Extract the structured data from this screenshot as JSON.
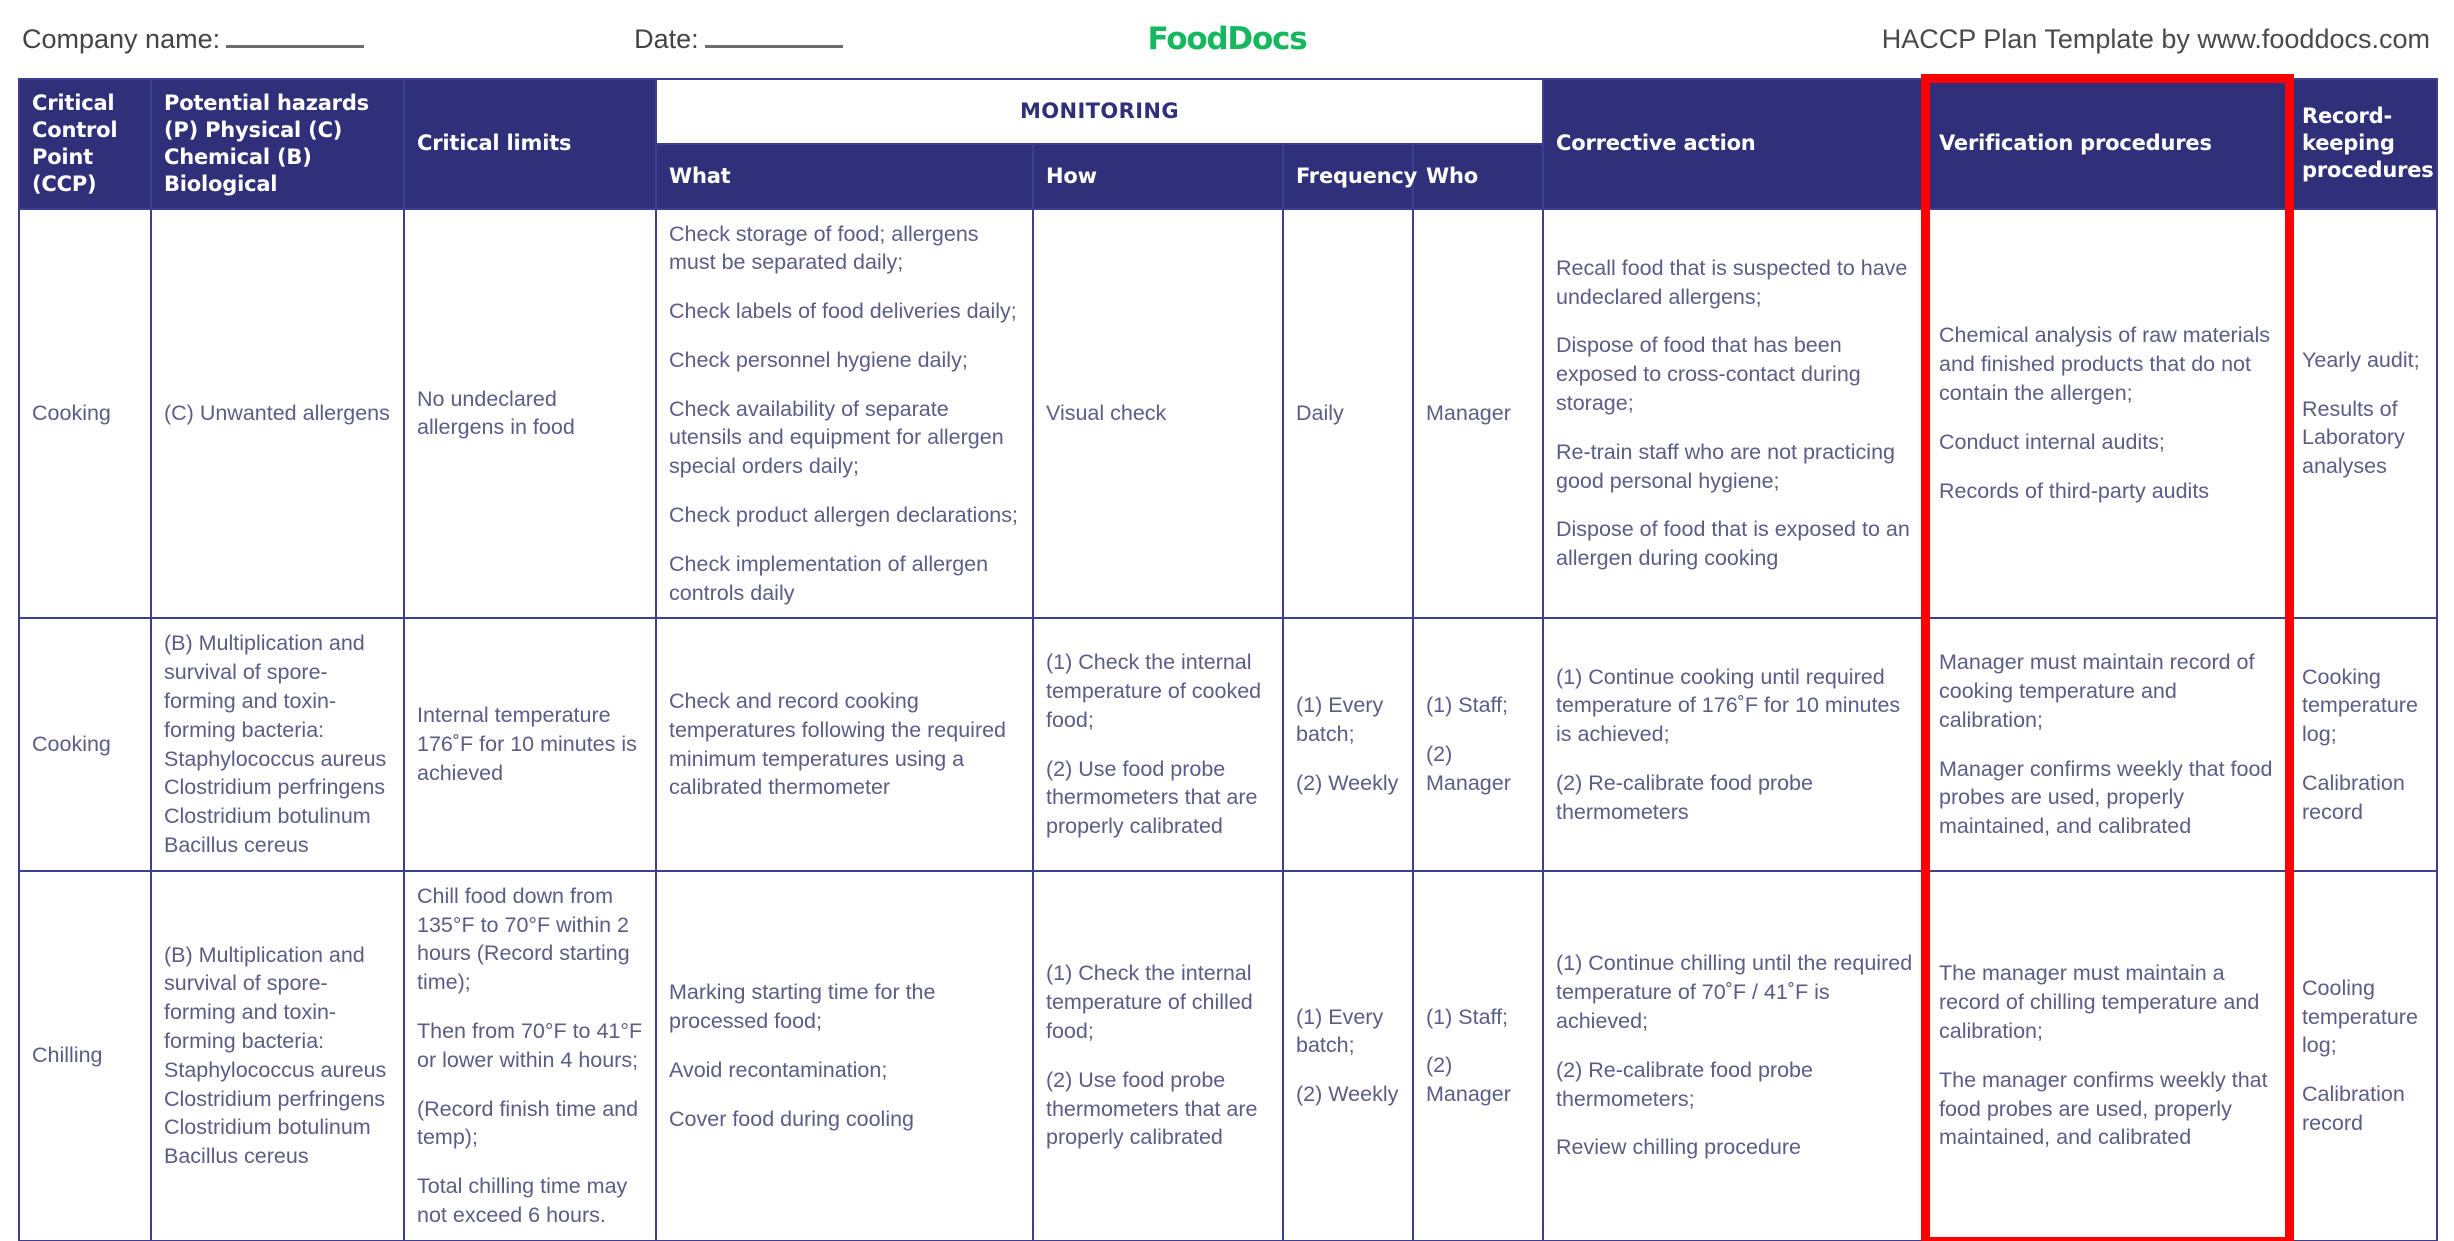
{
  "header": {
    "company_label": "Company name:",
    "date_label": "Date:",
    "logo_text": "FoodDocs",
    "logo_color": "#16b85f",
    "attribution": "HACCP Plan Template by www.fooddocs.com"
  },
  "theme": {
    "header_bg": "#2f2f7a",
    "border": "#3c3f8f",
    "body_text": "#5a5d86",
    "highlight": "#ff0000"
  },
  "table": {
    "group_header": "MONITORING",
    "columns": {
      "ccp": "Critical\nControl\nPoint\n(CCP)",
      "ccp_lines": [
        "Critical",
        "Control",
        "Point",
        "(CCP)"
      ],
      "hazards_lines": [
        "Potential hazards",
        "(P) Physical",
        "(C) Chemical",
        "(B) Biological"
      ],
      "critical_limits": "Critical limits",
      "what": "What",
      "how": "How",
      "frequency": "Frequency",
      "who": "Who",
      "corrective_action": "Corrective action",
      "verification": "Verification procedures",
      "recordkeeping_lines": [
        "Record-",
        "keeping",
        "procedures"
      ]
    },
    "rows": [
      {
        "ccp": "Cooking",
        "hazards": [
          "(C) Unwanted allergens"
        ],
        "critical_limits": [
          "No undeclared allergens in food"
        ],
        "what": [
          "Check storage of food; allergens must be separated daily;",
          "Check labels of food deliveries daily;",
          "Check personnel hygiene daily;",
          "Check availability of separate utensils and equipment for allergen special orders daily;",
          "Check product allergen declarations;",
          "Check implementation of allergen controls daily"
        ],
        "how": [
          "Visual check"
        ],
        "frequency": [
          "Daily"
        ],
        "who": [
          "Manager"
        ],
        "corrective_action": [
          "Recall food that is suspected to have undeclared allergens;",
          "Dispose of food that has been exposed to cross-contact during storage;",
          "Re-train staff who are not practicing good personal hygiene;",
          "Dispose of food that is exposed to an allergen during cooking"
        ],
        "verification": [
          "Chemical analysis of raw materials and finished products that do not contain the allergen;",
          "Conduct internal audits;",
          "Records of third-party audits"
        ],
        "recordkeeping": [
          "Yearly audit;",
          "Results of Laboratory analyses"
        ]
      },
      {
        "ccp": "Cooking",
        "hazards": [
          "(B) Multiplication and survival of spore-forming and toxin-forming bacteria: Staphylococcus aureus Clostridium perfringens Clostridium botulinum Bacillus cereus"
        ],
        "critical_limits": [
          "Internal temperature 176˚F for 10 minutes is achieved"
        ],
        "what": [
          "Check and record cooking temperatures following the required minimum temperatures using a calibrated thermometer"
        ],
        "how": [
          "(1) Check the internal temperature of cooked food;",
          "(2) Use food probe thermometers that are properly calibrated"
        ],
        "frequency": [
          "(1) Every batch;",
          "(2) Weekly"
        ],
        "who": [
          "(1) Staff;",
          "(2) Manager"
        ],
        "corrective_action": [
          "(1) Continue cooking until required temperature of 176˚F for 10 minutes is achieved;",
          "(2) Re-calibrate food probe thermometers"
        ],
        "verification": [
          "Manager must maintain record of cooking temperature and calibration;",
          "Manager confirms weekly that food probes are used, properly maintained, and calibrated"
        ],
        "recordkeeping": [
          "Cooking temperature log;",
          "Calibration record"
        ]
      },
      {
        "ccp": "Chilling",
        "hazards": [
          "(B) Multiplication and survival of spore-forming and toxin-forming bacteria: Staphylococcus aureus Clostridium perfringens Clostridium botulinum Bacillus cereus"
        ],
        "critical_limits": [
          "Chill food down from 135°F to 70°F within 2 hours (Record starting time);",
          "Then from 70°F to 41°F or lower within 4 hours;",
          "(Record finish time and temp);",
          "Total chilling time may not exceed 6 hours."
        ],
        "what": [
          "Marking starting time for the processed food;",
          "Avoid recontamination;",
          "Cover food during cooling"
        ],
        "how": [
          "(1) Check the internal temperature of chilled food;",
          "(2) Use food probe thermometers that are properly calibrated"
        ],
        "frequency": [
          "(1) Every batch;",
          "(2) Weekly"
        ],
        "who": [
          "(1) Staff;",
          "(2) Manager"
        ],
        "corrective_action": [
          "(1) Continue chilling until the required temperature of 70˚F / 41˚F is achieved;",
          "(2) Re-calibrate food probe thermometers;",
          "Review chilling procedure"
        ],
        "verification": [
          "The manager must maintain a record of chilling temperature and calibration;",
          "The manager confirms weekly that food probes are used, properly maintained, and calibrated"
        ],
        "recordkeeping": [
          "Cooling temperature log;",
          "Calibration record"
        ]
      }
    ]
  }
}
